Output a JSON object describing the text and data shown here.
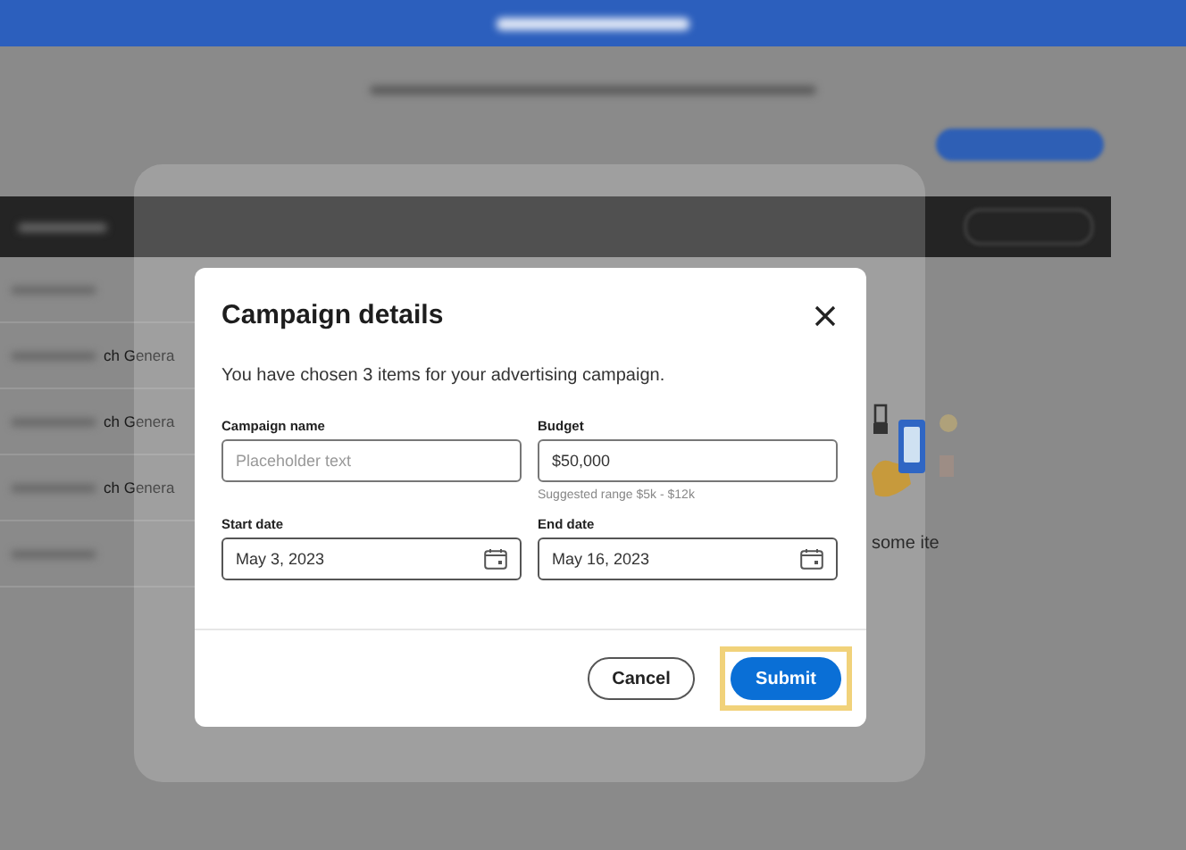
{
  "background": {
    "list_rows": [
      "ch Genera",
      "ch Genera",
      "ch Genera"
    ],
    "empty_state_text": "some ite"
  },
  "dialog": {
    "title": "Campaign details",
    "description": "You have chosen 3 items for your advertising campaign.",
    "fields": [
      {
        "kind": "text",
        "label": "Campaign name",
        "placeholder": "Placeholder text"
      },
      {
        "kind": "text",
        "label": "Budget",
        "value": "$50,000",
        "hint": "Suggested range $5k - $12k"
      },
      {
        "kind": "date",
        "label": "Start date",
        "value": "May 3, 2023"
      },
      {
        "kind": "date",
        "label": "End date",
        "value": "May 16, 2023"
      }
    ],
    "buttons": [
      {
        "kind": "secondary",
        "label": "Cancel",
        "focused": false
      },
      {
        "kind": "primary",
        "label": "Submit",
        "focused": true
      }
    ]
  }
}
